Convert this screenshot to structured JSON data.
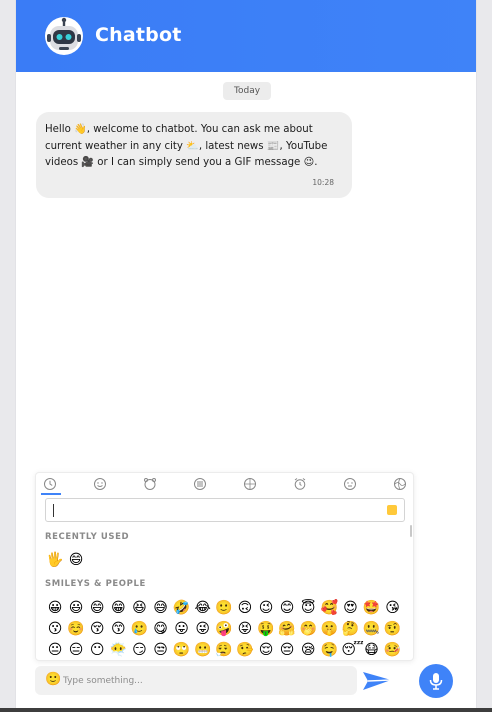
{
  "header": {
    "title": "Chatbot",
    "avatar_icon": "robot-icon"
  },
  "chat": {
    "date_label": "Today",
    "messages": [
      {
        "parts": [
          "Hello ",
          "👋",
          ", welcome to chatbot. You can ask me about current weather in any city ",
          "⛅",
          ", latest news ",
          "📰",
          ", YouTube videos ",
          "🎥",
          " or I can simply send you a GIF message ",
          "😉",
          "."
        ],
        "time": "10:28"
      }
    ]
  },
  "emoji_picker": {
    "categories": [
      {
        "name": "frequently-used",
        "icon": "🕓"
      },
      {
        "name": "smileys-people",
        "icon": "😀"
      },
      {
        "name": "animals-nature",
        "icon": "🐻"
      },
      {
        "name": "food-drink",
        "icon": "🍔"
      },
      {
        "name": "activity",
        "icon": "⚽"
      },
      {
        "name": "travel-places",
        "icon": "⏰"
      },
      {
        "name": "objects",
        "icon": "💡"
      },
      {
        "name": "flags",
        "icon": "🏳"
      }
    ],
    "recently_used_title": "RECENTLY USED",
    "recently_used": [
      "🖐",
      "😄"
    ],
    "smileys_title": "SMILEYS & PEOPLE",
    "smileys": [
      [
        "😀",
        "😃",
        "😄",
        "😁",
        "😆",
        "😅",
        "🤣",
        "😂",
        "🙂",
        "🙃",
        "😉",
        "😊",
        "😇",
        "🥰",
        "😍",
        "🤩",
        "😘"
      ],
      [
        "😗",
        "☺️",
        "😚",
        "😙",
        "🥲",
        "😋",
        "😛",
        "😜",
        "🤪",
        "😝",
        "🤑",
        "🤗",
        "🤭",
        "🤫",
        "🤔",
        "🤐",
        "🤨"
      ],
      [
        "😐",
        "😑",
        "😶",
        "😶‍🌫️",
        "😏",
        "😒",
        "🙄",
        "😬",
        "😮‍💨",
        "🤥",
        "😌",
        "😔",
        "😪",
        "🤤",
        "😴",
        "😷",
        "🤒"
      ]
    ],
    "skin_tone_color": "#ffc93a"
  },
  "composer": {
    "placeholder": "Type something...",
    "value": "",
    "emoji_icon": "🙂",
    "send_icon": "send-icon",
    "mic_icon": "microphone-icon"
  },
  "colors": {
    "accent": "#3f83f8",
    "bubble": "#eeeeee"
  }
}
